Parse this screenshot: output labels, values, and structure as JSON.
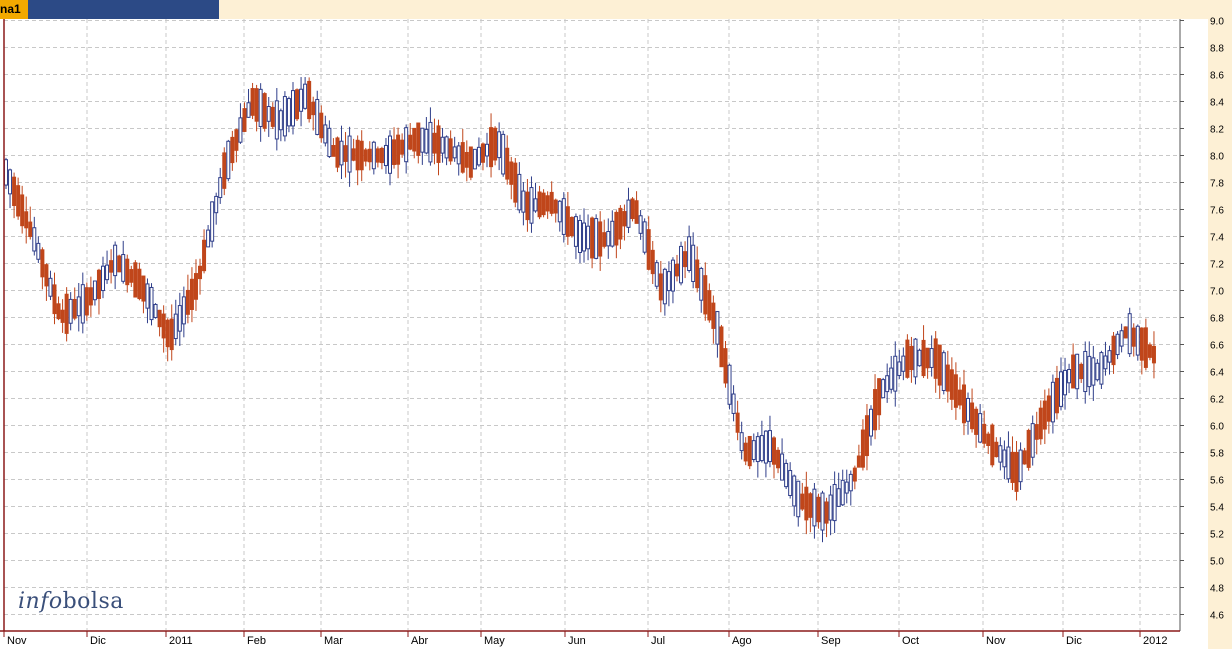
{
  "window": {
    "tab_label": "na1"
  },
  "watermark": {
    "part1": "info",
    "part2": "bolsa"
  },
  "colors": {
    "up": "#2f3e8a",
    "down": "#c0461b",
    "grid": "#c8c8c8",
    "frame": "#8b1a1a"
  },
  "chart_data": {
    "type": "candlestick",
    "title": "",
    "xlabel": "",
    "ylabel": "",
    "ylim": [
      4.5,
      9.0
    ],
    "grid": true,
    "y_ticks": [
      "4.6",
      "4.8",
      "5.0",
      "5.2",
      "5.4",
      "5.6",
      "5.8",
      "6.0",
      "6.2",
      "6.4",
      "6.6",
      "6.8",
      "7.0",
      "7.2",
      "7.4",
      "7.6",
      "7.8",
      "8.0",
      "8.2",
      "8.4",
      "8.6",
      "8.8",
      "9.0"
    ],
    "x_ticks": [
      "Nov",
      "Dic",
      "2011",
      "Feb",
      "Mar",
      "Abr",
      "May",
      "Jun",
      "Jul",
      "Ago",
      "Sep",
      "Oct",
      "Nov",
      "Dic",
      "2012"
    ],
    "series": [
      {
        "values": [
          [
            "Nov 2010",
            8.1,
            7.65
          ],
          [
            "Nov 2010",
            7.65,
            7.15
          ],
          [
            "Dic 2010",
            7.2,
            6.4
          ],
          [
            "Dic 2010",
            6.55,
            7.3
          ],
          [
            "Dic 2010",
            7.45,
            7.0
          ],
          [
            "Dic 2010",
            7.2,
            6.85
          ],
          [
            "Ene 2011",
            6.95,
            6.35
          ],
          [
            "Ene 2011",
            6.5,
            7.6
          ],
          [
            "Ene 2011",
            7.6,
            8.2
          ],
          [
            "Feb 2011",
            8.2,
            8.6
          ],
          [
            "Feb 2011",
            8.5,
            8.0
          ],
          [
            "Feb 2011",
            8.2,
            8.7
          ],
          [
            "Mar 2011",
            8.4,
            7.65
          ],
          [
            "Mar 2011",
            7.7,
            8.3
          ],
          [
            "Mar 2011",
            8.2,
            7.8
          ],
          [
            "Abr 2011",
            7.85,
            8.4
          ],
          [
            "Abr 2011",
            8.5,
            7.65
          ],
          [
            "Abr 2011",
            7.7,
            8.2
          ],
          [
            "May 2011",
            8.3,
            7.9
          ],
          [
            "May 2011",
            7.8,
            7.45
          ],
          [
            "Jun 2011",
            7.5,
            7.8
          ],
          [
            "Jun 2011",
            7.6,
            7.2
          ],
          [
            "Jun 2011",
            7.15,
            7.6
          ],
          [
            "Jul 2011",
            7.95,
            7.3
          ],
          [
            "Jul 2011",
            7.2,
            6.8
          ],
          [
            "Jul 2011",
            6.85,
            7.7
          ],
          [
            "Ago 2011",
            7.3,
            6.2
          ],
          [
            "Ago 2011",
            6.0,
            5.6
          ],
          [
            "Ago 2011",
            5.8,
            5.9
          ],
          [
            "Sep 2011",
            5.7,
            5.2
          ],
          [
            "Sep 2011",
            4.95,
            5.75
          ],
          [
            "Sep 2011",
            5.2,
            6.0
          ],
          [
            "Oct 2011",
            6.0,
            6.5
          ],
          [
            "Oct 2011",
            6.7,
            6.3
          ],
          [
            "Oct 2011",
            6.1,
            6.9
          ],
          [
            "Nov 2011",
            6.4,
            5.95
          ],
          [
            "Nov 2011",
            5.95,
            5.8
          ],
          [
            "Nov 2011",
            5.8,
            5.5
          ],
          [
            "Dic 2011",
            5.75,
            6.4
          ],
          [
            "Dic 2011",
            6.7,
            6.1
          ],
          [
            "Dic 2011",
            6.2,
            6.6
          ],
          [
            "Dic 2011",
            6.6,
            6.8
          ],
          [
            "Ene 2012",
            6.75,
            6.3
          ]
        ]
      }
    ]
  }
}
